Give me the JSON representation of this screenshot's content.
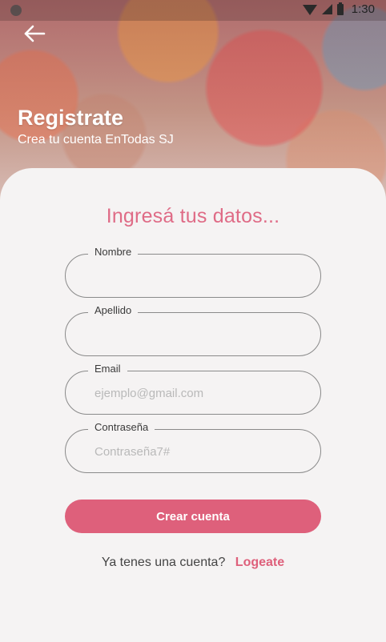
{
  "status_bar": {
    "time": "1:30",
    "icons": [
      "wifi-icon",
      "signal-icon",
      "battery-icon"
    ]
  },
  "header": {
    "back_icon": "arrow-left-icon",
    "title": "Registrate",
    "subtitle": "Crea tu cuenta EnTodas SJ"
  },
  "form": {
    "heading": "Ingresá tus datos...",
    "fields": [
      {
        "label": "Nombre",
        "value": "",
        "placeholder": ""
      },
      {
        "label": "Apellido",
        "value": "",
        "placeholder": ""
      },
      {
        "label": "Email",
        "value": "",
        "placeholder": "ejemplo@gmail.com"
      },
      {
        "label": "Contraseña",
        "value": "",
        "placeholder": "Contraseña7#"
      }
    ],
    "submit_label": "Crear cuenta"
  },
  "footer": {
    "prompt": "Ya tenes una cuenta?",
    "link_label": "Logeate"
  },
  "colors": {
    "accent": "#de607b",
    "heading": "#df6b86",
    "background": "#f5f3f3"
  }
}
